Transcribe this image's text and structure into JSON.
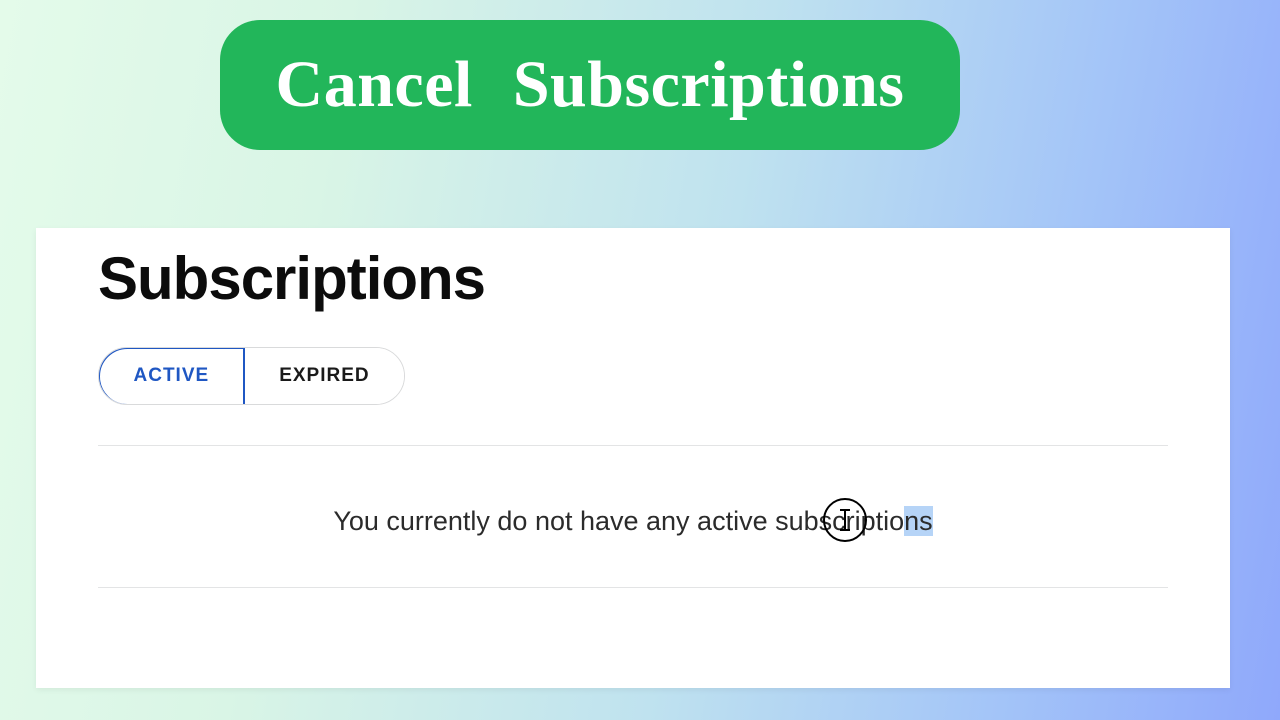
{
  "banner": {
    "word1": "Cancel",
    "word2": "Subscriptions"
  },
  "page": {
    "title": "Subscriptions"
  },
  "tabs": {
    "active": "ACTIVE",
    "expired": "EXPIRED"
  },
  "empty": {
    "prefix": "You currently do not have any active subscriptio",
    "selected": "ns"
  }
}
